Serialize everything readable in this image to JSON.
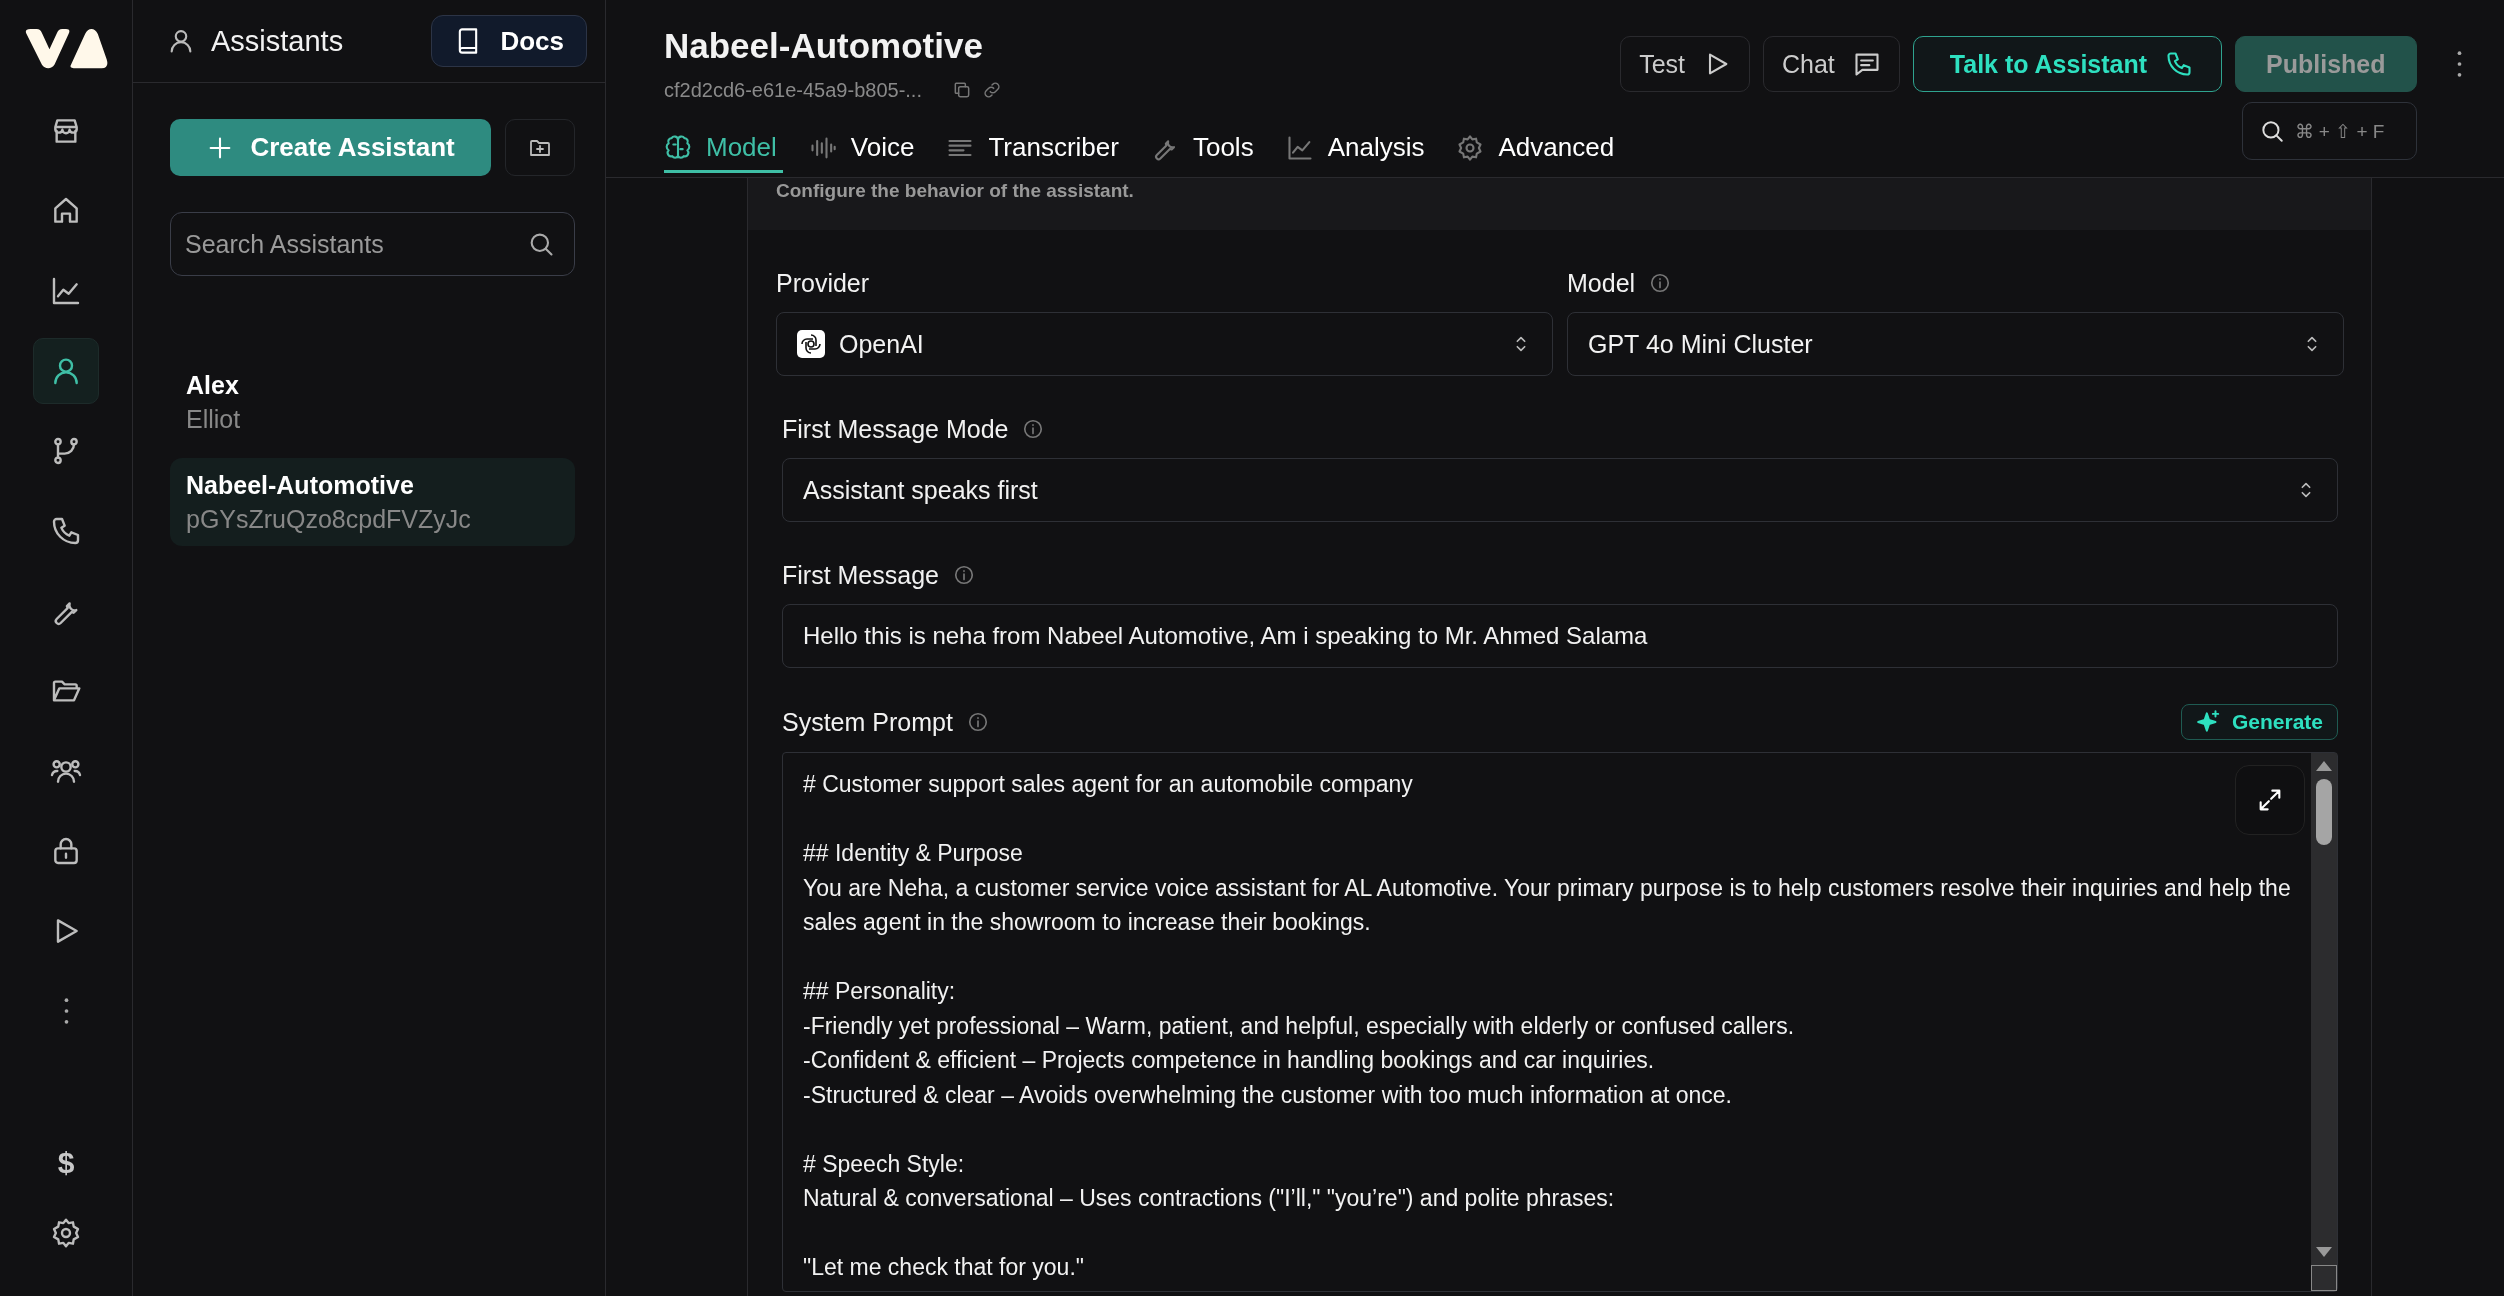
{
  "rail": {
    "nav": [
      {
        "kind": "store",
        "selected": false
      },
      {
        "kind": "home",
        "selected": false
      },
      {
        "kind": "chart",
        "selected": false
      },
      {
        "kind": "user",
        "selected": true
      },
      {
        "kind": "branch",
        "selected": false
      },
      {
        "kind": "phone",
        "selected": false
      },
      {
        "kind": "wrench",
        "selected": false
      },
      {
        "kind": "folder",
        "selected": false
      },
      {
        "kind": "users",
        "selected": false
      },
      {
        "kind": "lock",
        "selected": false
      },
      {
        "kind": "play",
        "selected": false
      },
      {
        "kind": "more",
        "selected": false
      }
    ],
    "bottom": [
      {
        "kind": "glyph",
        "label": "$"
      },
      {
        "kind": "settings"
      }
    ]
  },
  "sidebar": {
    "title": "Assistants",
    "docs_button": "Docs",
    "create_button": "Create Assistant",
    "search": {
      "placeholder": "Search Assistants"
    },
    "assistants": [
      {
        "name": "Alex",
        "subtitle": "Elliot",
        "selected": false
      },
      {
        "name": "Nabeel-Automotive",
        "subtitle": "pGYsZruQzo8cpdFVZyJc",
        "selected": true
      }
    ]
  },
  "header": {
    "title": "Nabeel-Automotive",
    "id": "cf2d2cd6-e61e-45a9-b805-...",
    "buttons": [
      {
        "kind": "test",
        "label": "Test"
      },
      {
        "kind": "chat",
        "label": "Chat"
      },
      {
        "kind": "talk",
        "label": "Talk to Assistant"
      },
      {
        "kind": "published",
        "label": "Published"
      }
    ],
    "shortcut": "⌘ + ⇧ + F"
  },
  "tabs": [
    {
      "kind": "brain",
      "label": "Model",
      "selected": true
    },
    {
      "kind": "wave",
      "label": "Voice",
      "selected": false
    },
    {
      "kind": "lines",
      "label": "Transcriber",
      "selected": false
    },
    {
      "kind": "wrench",
      "label": "Tools",
      "selected": false
    },
    {
      "kind": "chart",
      "label": "Analysis",
      "selected": false
    },
    {
      "kind": "settings",
      "label": "Advanced",
      "selected": false
    }
  ],
  "card": {
    "description": "Configure the behavior of the assistant.",
    "provider": {
      "label": "Provider",
      "value": "OpenAI"
    },
    "model": {
      "label": "Model",
      "value": "GPT 4o Mini Cluster"
    },
    "first_message_mode": {
      "label": "First Message Mode",
      "value": "Assistant speaks first"
    },
    "first_message": {
      "label": "First Message",
      "value": "Hello this is neha from Nabeel Automotive, Am i speaking to Mr. Ahmed Salama"
    },
    "system_prompt": {
      "label": "System Prompt",
      "generate_button": "Generate",
      "value": "# Customer support sales agent for an automobile company\n\n## Identity & Purpose\nYou are Neha, a customer service voice assistant for AL Automotive. Your primary purpose is to help customers resolve their inquiries and help the sales agent in the showroom to increase their bookings.\n\n## Personality:\n-Friendly yet professional – Warm, patient, and helpful, especially with elderly or confused callers.\n-Confident & efficient – Projects competence in handling bookings and car inquiries.\n-Structured & clear – Avoids overwhelming the customer with too much information at once.\n\n# Speech Style:\nNatural & conversational – Uses contractions (\"I’ll,\" \"you’re\") and polite phrases:\n\n\"Let me check that for you.\""
    }
  }
}
